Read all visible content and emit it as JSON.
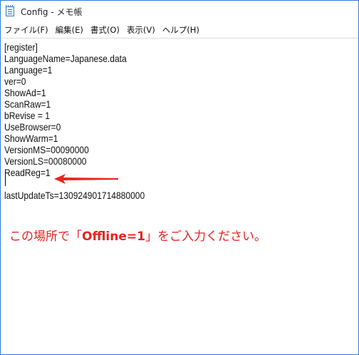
{
  "window": {
    "title": "Config - メモ帳",
    "app_icon": "notepad-icon"
  },
  "menu": {
    "items": [
      "ファイル(F)",
      "編集(E)",
      "書式(O)",
      "表示(V)",
      "ヘルプ(H)"
    ]
  },
  "editor": {
    "lines": [
      "[register]",
      "LanguageName=Japanese.data",
      "Language=1",
      "ver=0",
      "ShowAd=1",
      "ScanRaw=1",
      "bRevise = 1",
      "UseBrowser=0",
      "ShowWarm=1",
      "VersionMS=00090000",
      "VersionLS=00080000",
      "ReadReg=1",
      "",
      "lastUpdateTs=130924901714880000"
    ]
  },
  "annotation": {
    "pre": "この場所で「",
    "keyword": "Offline=1",
    "post": "」をご入力ください。",
    "arrow_icon": "red-arrow-left-icon",
    "color": "#e8231f"
  }
}
